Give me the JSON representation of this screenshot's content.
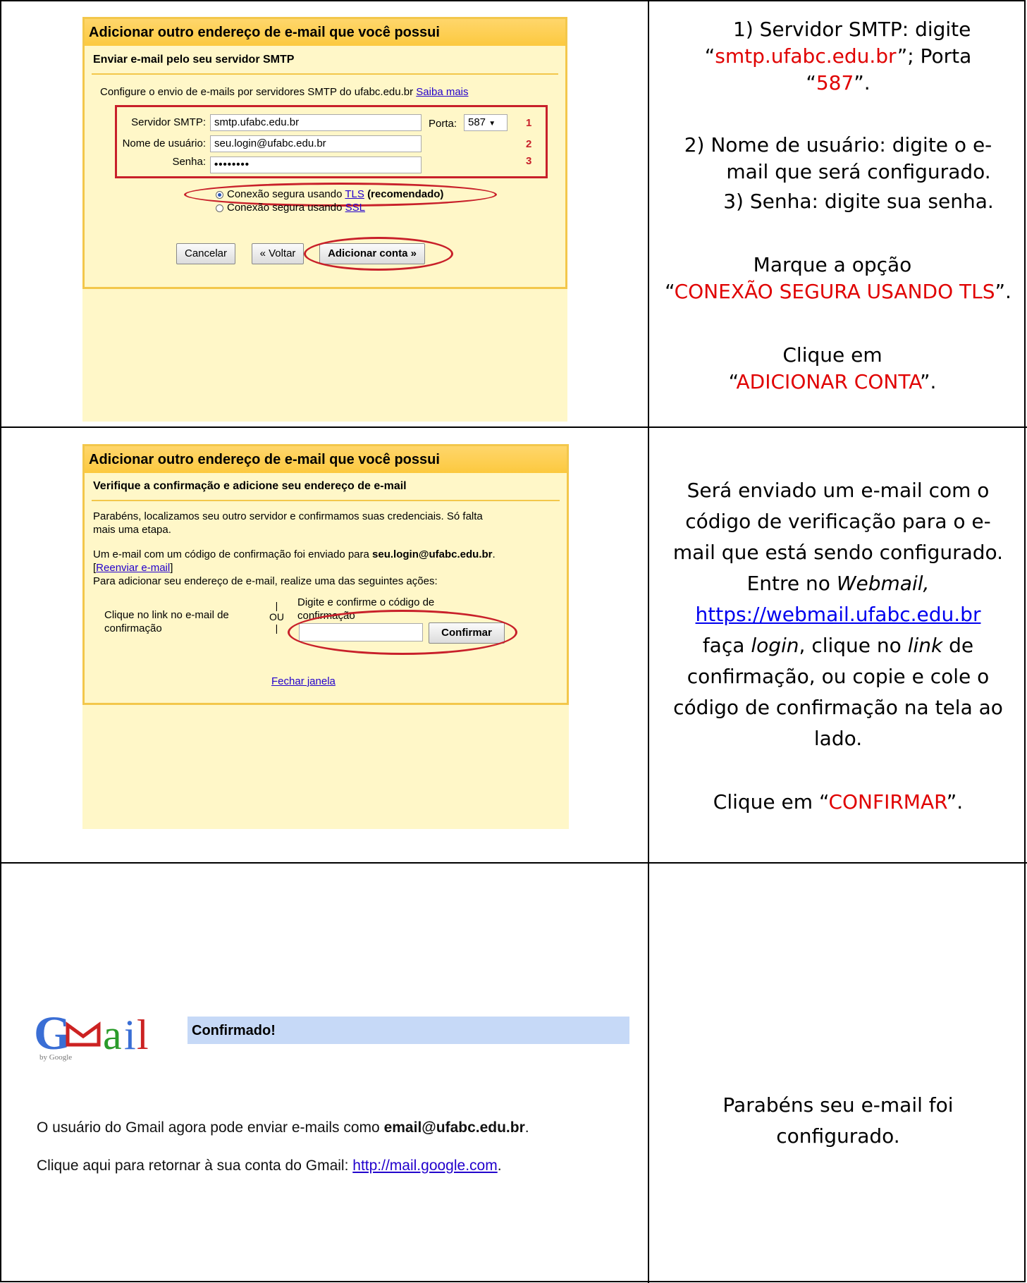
{
  "row1": {
    "dialog": {
      "title": "Adicionar outro endereço de e-mail que você possui",
      "subtitle": "Enviar e-mail pelo seu servidor SMTP",
      "intro": "Configure o envio de e-mails por servidores SMTP do ufabc.edu.br",
      "intro_link": "Saiba mais",
      "smtp_label": "Servidor SMTP:",
      "smtp_value": "smtp.ufabc.edu.br",
      "port_label": "Porta:",
      "port_value": "587",
      "user_label": "Nome de usuário:",
      "user_value": "seu.login@ufabc.edu.br",
      "password_label": "Senha:",
      "password_value": "••••••••",
      "marker_1": "1",
      "marker_2": "2",
      "marker_3": "3",
      "tls_text": "Conexão segura usando",
      "tls_link": "TLS",
      "tls_rec": "(recomendado)",
      "ssl_text": "Conexão segura usando",
      "ssl_link": "SSL",
      "cancel_label": "Cancelar",
      "back_label": "« Voltar",
      "add_label": "Adicionar conta »"
    },
    "instructions": {
      "step1_a": "1)  Servidor SMTP: digite",
      "step1_q1": "“",
      "step1_server": "smtp.ufabc.edu.br",
      "step1_b": "”; Porta",
      "step1_q2": "“",
      "step1_port": "587",
      "step1_c": "”.",
      "step2_a": "2)  Nome de usuário: digite o e-",
      "step2_b": "mail que será configurado.",
      "step3": "3)  Senha: digite sua senha.",
      "mark_a": "Marque a opção",
      "mark_q1": "“",
      "mark_opt": "CONEXÃO SEGURA USANDO TLS",
      "mark_q2": "”.",
      "click_a": "Clique em",
      "click_q1": "“",
      "click_opt": "ADICIONAR CONTA",
      "click_q2": "”."
    }
  },
  "row2": {
    "dialog": {
      "title": "Adicionar outro endereço de e-mail que você possui",
      "subtitle": "Verifique a confirmação e adicione seu endereço de e-mail",
      "p1": "Parabéns, localizamos seu outro servidor e confirmamos suas credenciais. Só falta",
      "p1b": "mais uma etapa.",
      "p2": "Um e-mail com um código de confirmação foi enviado para",
      "p2_email": "seu.login@ufabc.edu.br",
      "p2_end": ".",
      "resend": "Reenviar e-mail",
      "p3": "Para adicionar seu endereço de e-mail, realize uma das seguintes ações:",
      "left_option_a": "Clique no link no e-mail de",
      "left_option_b": "confirmação",
      "ou": "OU",
      "right_option_a": "Digite e confirme o código de",
      "right_option_b": "confirmação",
      "confirm_label": "Confirmar",
      "close_label": "Fechar janela"
    },
    "instructions": {
      "l1": "Será enviado um e-mail com o",
      "l2": "código de verificação para o e-",
      "l3": "mail que está sendo configurado.",
      "l4_a": "Entre no",
      "l4_b": "Webmail,",
      "l5": "https://webmail.ufabc.edu.br",
      "l6_a": "faça",
      "l6_b": "login",
      "l6_c": ", clique no",
      "l6_d": "link",
      "l6_e": "de",
      "l7": "confirmação, ou copie e cole o",
      "l8": "código de confirmação na tela ao",
      "l9": "lado.",
      "click_a": "Clique em “",
      "click_opt": "CONFIRMAR",
      "click_b": "”."
    }
  },
  "row3": {
    "logo_text": "Gmail",
    "logo_by": "by Google",
    "banner": "Confirmado!",
    "msg1_a": "O usuário do Gmail agora pode enviar e-mails como",
    "msg1_email": "email@ufabc.edu.br",
    "msg1_end": ".",
    "msg2_a": "Clique aqui para retornar à sua conta do Gmail:",
    "msg2_link": "http://mail.google.com",
    "msg2_end": ".",
    "instructions_a": "Parabéns seu e-mail foi",
    "instructions_b": "configurado."
  }
}
